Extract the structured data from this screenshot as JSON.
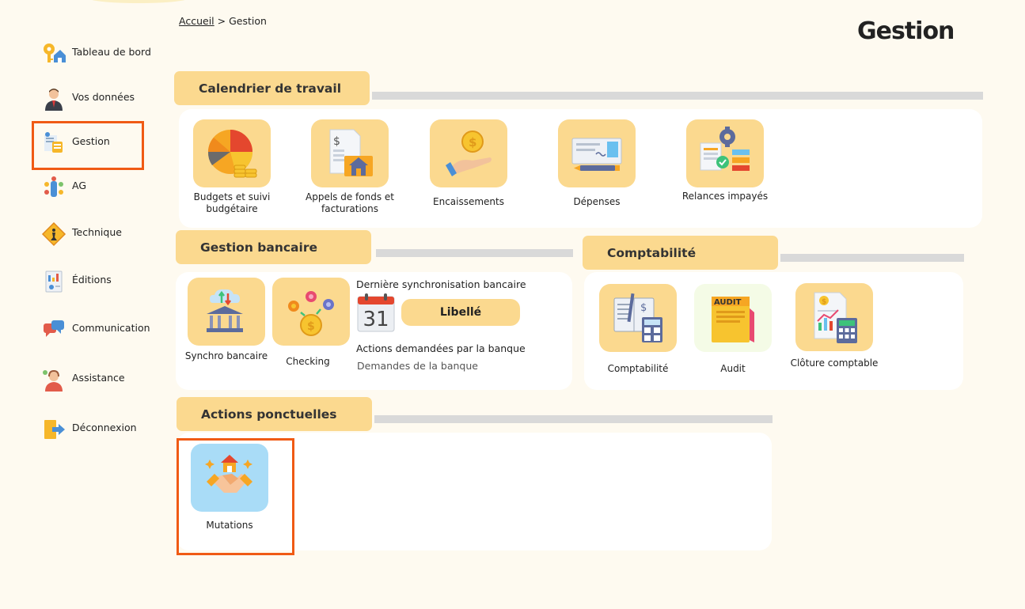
{
  "breadcrumb": {
    "home": "Accueil",
    "separator": ">",
    "current": "Gestion"
  },
  "page_title": "Gestion",
  "sidebar": {
    "items": [
      {
        "label": "Tableau de bord",
        "icon": "dashboard-key-icon"
      },
      {
        "label": "Vos données",
        "icon": "user-avatar-icon"
      },
      {
        "label": "Gestion",
        "icon": "management-icon"
      },
      {
        "label": "AG",
        "icon": "meeting-icon"
      },
      {
        "label": "Technique",
        "icon": "worker-sign-icon"
      },
      {
        "label": "Éditions",
        "icon": "report-icon"
      },
      {
        "label": "Communication",
        "icon": "chat-bubbles-icon"
      },
      {
        "label": "Assistance",
        "icon": "support-agent-icon"
      },
      {
        "label": "Déconnexion",
        "icon": "logout-icon"
      }
    ]
  },
  "sections": {
    "calendrier": {
      "title": "Calendrier de travail",
      "tiles": [
        {
          "label": "Budgets et suivi budgétaire",
          "icon": "pie-chart-coins-icon"
        },
        {
          "label": "Appels de fonds et facturations",
          "icon": "invoice-house-icon"
        },
        {
          "label": "Encaissements",
          "icon": "hand-coin-icon"
        },
        {
          "label": "Dépenses",
          "icon": "cheque-icon"
        },
        {
          "label": "Relances impayés",
          "icon": "gear-reminder-icon"
        }
      ]
    },
    "bancaire": {
      "title": "Gestion bancaire",
      "tiles": [
        {
          "label": "Synchro bancaire",
          "icon": "bank-cloud-sync-icon"
        },
        {
          "label": "Checking",
          "icon": "coins-network-icon"
        }
      ],
      "sync_title": "Dernière synchronisation bancaire",
      "calendar_day": "31",
      "libelle": "Libellé",
      "actions_label": "Actions demandées par la banque",
      "demandes_label": "Demandes de la banque"
    },
    "comptabilite": {
      "title": "Comptabilité",
      "tiles": [
        {
          "label": "Comptabilité",
          "icon": "ledger-calculator-icon"
        },
        {
          "label": "Audit",
          "icon": "audit-folder-icon",
          "audit_text": "AUDIT"
        },
        {
          "label": "Clôture comptable",
          "icon": "report-calculator-icon"
        }
      ]
    },
    "ponctuelles": {
      "title": "Actions ponctuelles",
      "tiles": [
        {
          "label": "Mutations",
          "icon": "handshake-house-icon"
        }
      ]
    }
  },
  "colors": {
    "accent": "#fbd98f",
    "highlight": "#f05a14",
    "background": "#fefaf0",
    "mutation_tile": "#a9dcf7",
    "audit_tile": "#f4fbe6"
  }
}
